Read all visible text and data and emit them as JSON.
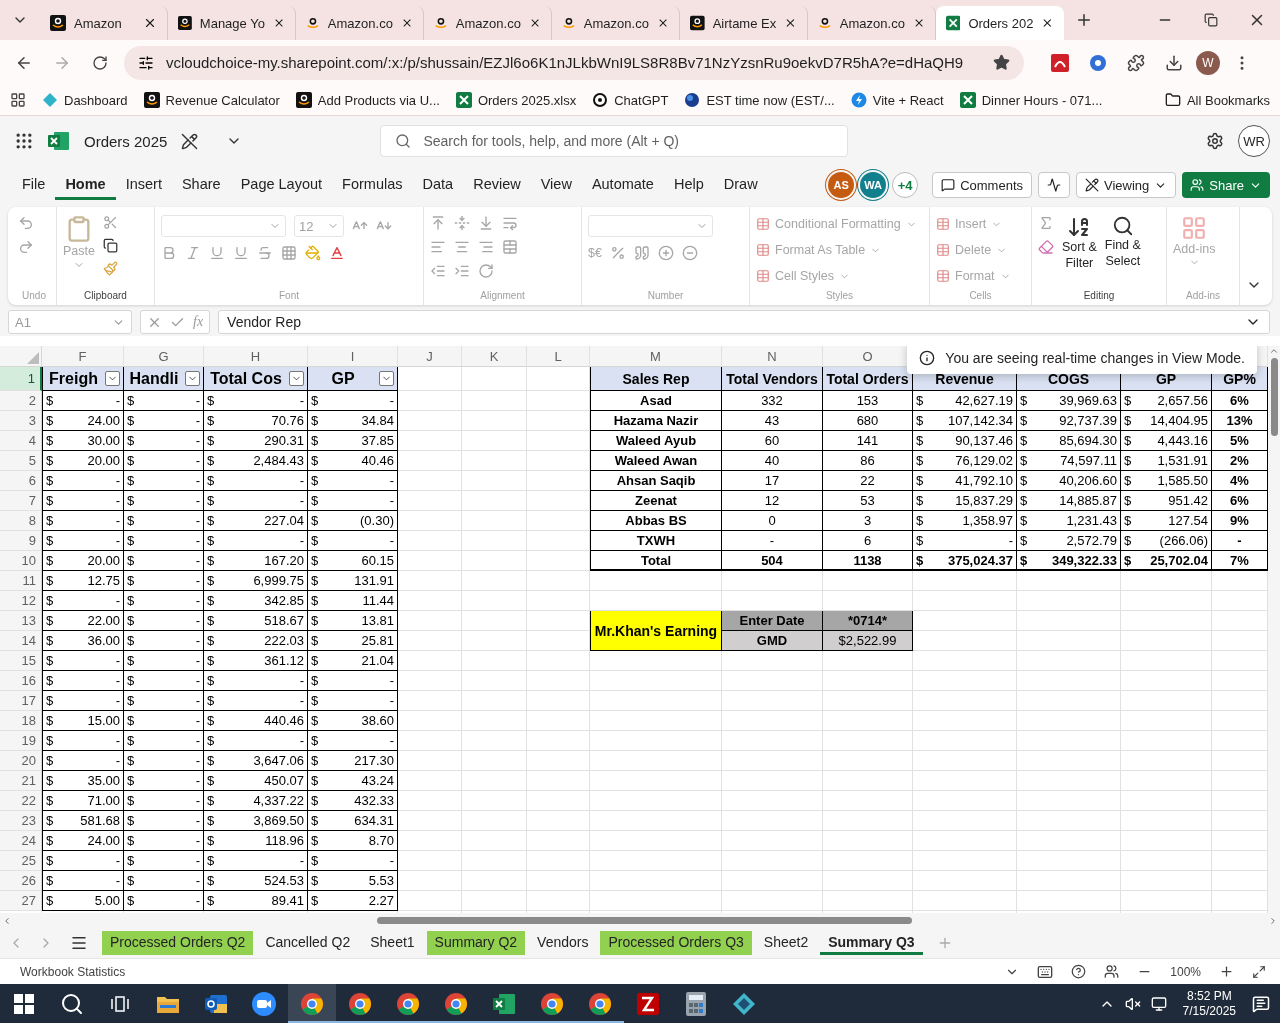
{
  "browser": {
    "tabs": [
      {
        "label": "Amazon",
        "kind": "dark",
        "selected": false
      },
      {
        "label": "Manage Yo",
        "kind": "dark",
        "selected": false
      },
      {
        "label": "Amazon.co",
        "kind": "light",
        "selected": false
      },
      {
        "label": "Amazon.co",
        "kind": "light",
        "selected": false
      },
      {
        "label": "Amazon.co",
        "kind": "light",
        "selected": false
      },
      {
        "label": "Airtame Ex",
        "kind": "dark",
        "selected": false
      },
      {
        "label": "Amazon.co",
        "kind": "light",
        "selected": false
      },
      {
        "label": "Orders 202",
        "kind": "sheet",
        "selected": true
      }
    ],
    "address": "vcloudchoice-my.sharepoint.com/:x:/p/shussain/EZJl6o6K1nJLkbWnI9LS8R8Bv71NzYzsnRu9oekvD7R5hA?e=dHaQH9",
    "profile": "W",
    "bookmarks": [
      {
        "label": "Dashboard",
        "kind": "diamond"
      },
      {
        "label": "Revenue Calculator",
        "kind": "dark"
      },
      {
        "label": "Add Products via U...",
        "kind": "dark"
      },
      {
        "label": "Orders 2025.xlsx",
        "kind": "sheet"
      },
      {
        "label": "ChatGPT",
        "kind": "knot"
      },
      {
        "label": "EST time now (EST/...",
        "kind": "globe"
      },
      {
        "label": "Vite + React",
        "kind": "bolt"
      },
      {
        "label": "Dinner Hours - 071...",
        "kind": "sheet"
      }
    ],
    "all_bookmarks": "All Bookmarks"
  },
  "excel": {
    "title": "Orders 2025",
    "search_placeholder": "Search for tools, help, and more (Alt + Q)",
    "user": "WR",
    "menu": [
      {
        "label": "File",
        "selected": false
      },
      {
        "label": "Home",
        "selected": true
      },
      {
        "label": "Insert",
        "selected": false
      },
      {
        "label": "Share",
        "selected": false
      },
      {
        "label": "Page Layout",
        "selected": false
      },
      {
        "label": "Formulas",
        "selected": false
      },
      {
        "label": "Data",
        "selected": false
      },
      {
        "label": "Review",
        "selected": false
      },
      {
        "label": "View",
        "selected": false
      },
      {
        "label": "Automate",
        "selected": false
      },
      {
        "label": "Help",
        "selected": false
      },
      {
        "label": "Draw",
        "selected": false
      }
    ],
    "presence": [
      {
        "initials": "AS",
        "color": "#c55a11"
      },
      {
        "initials": "WA",
        "color": "#127f8c"
      }
    ],
    "presence_more": "+4",
    "comments": "Comments",
    "viewing": "Viewing",
    "share": "Share",
    "ribbon": [
      {
        "kind": "undo",
        "label": "Undo",
        "disabled": true
      },
      {
        "kind": "clipboard",
        "label": "Clipboard",
        "disabled": false,
        "paste": "Paste"
      },
      {
        "kind": "font",
        "label": "Font",
        "disabled": true,
        "size": "12"
      },
      {
        "kind": "alignment",
        "label": "Alignment",
        "disabled": true
      },
      {
        "kind": "number",
        "label": "Number",
        "disabled": true,
        "currency": "$€"
      },
      {
        "kind": "list",
        "label": "Styles",
        "disabled": true,
        "items": [
          "Conditional Formatting",
          "Format As Table",
          "Cell Styles"
        ]
      },
      {
        "kind": "list",
        "label": "Cells",
        "disabled": true,
        "items": [
          "Insert",
          "Delete",
          "Format"
        ]
      },
      {
        "kind": "editing",
        "label": "Editing",
        "disabled": false,
        "buttons": [
          {
            "lines": [
              "Sort &",
              "Filter"
            ]
          },
          {
            "lines": [
              "Find &",
              "Select"
            ]
          }
        ]
      },
      {
        "kind": "addins",
        "label": "Add-ins",
        "disabled": true,
        "button": "Add-ins"
      }
    ],
    "formula_bar": {
      "name_box": "A1",
      "fx": "fx",
      "value": "Vendor Rep"
    }
  },
  "sheet": {
    "column_headers": [
      "F",
      "G",
      "H",
      "I",
      "J",
      "K",
      "L",
      "M",
      "N",
      "O"
    ],
    "row_numbers": [
      {
        "label": "1",
        "selected": true
      },
      {
        "label": "2",
        "selected": false
      },
      {
        "label": "3",
        "selected": false
      },
      {
        "label": "4",
        "selected": false
      },
      {
        "label": "5",
        "selected": false
      },
      {
        "label": "6",
        "selected": false
      },
      {
        "label": "7",
        "selected": false
      },
      {
        "label": "8",
        "selected": false
      },
      {
        "label": "9",
        "selected": false
      },
      {
        "label": "10",
        "selected": false
      },
      {
        "label": "11",
        "selected": false
      },
      {
        "label": "12",
        "selected": false
      },
      {
        "label": "13",
        "selected": false
      },
      {
        "label": "14",
        "selected": false
      },
      {
        "label": "15",
        "selected": false
      },
      {
        "label": "16",
        "selected": false
      },
      {
        "label": "17",
        "selected": false
      },
      {
        "label": "18",
        "selected": false
      },
      {
        "label": "19",
        "selected": false
      },
      {
        "label": "20",
        "selected": false
      },
      {
        "label": "21",
        "selected": false
      },
      {
        "label": "22",
        "selected": false
      },
      {
        "label": "23",
        "selected": false
      },
      {
        "label": "24",
        "selected": false
      },
      {
        "label": "25",
        "selected": false
      },
      {
        "label": "26",
        "selected": false
      },
      {
        "label": "27",
        "selected": false
      }
    ],
    "left_table": {
      "headers": [
        "Freigh",
        "Handli",
        "Total Cos",
        "GP"
      ],
      "rows": [
        [
          "$",
          "-",
          "$",
          "-",
          "$",
          "-",
          "$",
          "-"
        ],
        [
          "$",
          "24.00",
          "$",
          "-",
          "$",
          "70.76",
          "$",
          "34.84"
        ],
        [
          "$",
          "30.00",
          "$",
          "-",
          "$",
          "290.31",
          "$",
          "37.85"
        ],
        [
          "$",
          "20.00",
          "$",
          "-",
          "$",
          "2,484.43",
          "$",
          "40.46"
        ],
        [
          "$",
          "-",
          "$",
          "-",
          "$",
          "-",
          "$",
          "-"
        ],
        [
          "$",
          "-",
          "$",
          "-",
          "$",
          "-",
          "$",
          "-"
        ],
        [
          "$",
          "-",
          "$",
          "-",
          "$",
          "227.04",
          "$",
          "(0.30)"
        ],
        [
          "$",
          "-",
          "$",
          "-",
          "$",
          "-",
          "$",
          "-"
        ],
        [
          "$",
          "20.00",
          "$",
          "-",
          "$",
          "167.20",
          "$",
          "60.15"
        ],
        [
          "$",
          "12.75",
          "$",
          "-",
          "$",
          "6,999.75",
          "$",
          "131.91"
        ],
        [
          "$",
          "-",
          "$",
          "-",
          "$",
          "342.85",
          "$",
          "11.44"
        ],
        [
          "$",
          "22.00",
          "$",
          "-",
          "$",
          "518.67",
          "$",
          "13.81"
        ],
        [
          "$",
          "36.00",
          "$",
          "-",
          "$",
          "222.03",
          "$",
          "25.81"
        ],
        [
          "$",
          "-",
          "$",
          "-",
          "$",
          "361.12",
          "$",
          "21.04"
        ],
        [
          "$",
          "-",
          "$",
          "-",
          "$",
          "-",
          "$",
          "-"
        ],
        [
          "$",
          "-",
          "$",
          "-",
          "$",
          "-",
          "$",
          "-"
        ],
        [
          "$",
          "15.00",
          "$",
          "-",
          "$",
          "440.46",
          "$",
          "38.60"
        ],
        [
          "$",
          "-",
          "$",
          "-",
          "$",
          "-",
          "$",
          "-"
        ],
        [
          "$",
          "-",
          "$",
          "-",
          "$",
          "3,647.06",
          "$",
          "217.30"
        ],
        [
          "$",
          "35.00",
          "$",
          "-",
          "$",
          "450.07",
          "$",
          "43.24"
        ],
        [
          "$",
          "71.00",
          "$",
          "-",
          "$",
          "4,337.22",
          "$",
          "432.33"
        ],
        [
          "$",
          "581.68",
          "$",
          "-",
          "$",
          "3,869.50",
          "$",
          "634.31"
        ],
        [
          "$",
          "24.00",
          "$",
          "-",
          "$",
          "118.96",
          "$",
          "8.70"
        ],
        [
          "$",
          "-",
          "$",
          "-",
          "$",
          "-",
          "$",
          "-"
        ],
        [
          "$",
          "-",
          "$",
          "-",
          "$",
          "524.53",
          "$",
          "5.53"
        ],
        [
          "$",
          "5.00",
          "$",
          "-",
          "$",
          "89.41",
          "$",
          "2.27"
        ]
      ]
    },
    "summary": {
      "headers": [
        "Sales Rep",
        "Total Vendors",
        "Total Orders",
        "Revenue",
        "COGS",
        "GP",
        "GP%"
      ],
      "rows": [
        {
          "kind": "data",
          "cells": [
            "Asad",
            "332",
            "153",
            [
              "$",
              "42,627.19"
            ],
            [
              "$",
              "39,969.63"
            ],
            [
              "$",
              "2,657.56"
            ],
            "6%"
          ]
        },
        {
          "kind": "data",
          "cells": [
            "Hazama Nazir",
            "43",
            "680",
            [
              "$",
              "107,142.34"
            ],
            [
              "$",
              "92,737.39"
            ],
            [
              "$",
              "14,404.95"
            ],
            "13%"
          ]
        },
        {
          "kind": "data",
          "cells": [
            "Waleed Ayub",
            "60",
            "141",
            [
              "$",
              "90,137.46"
            ],
            [
              "$",
              "85,694.30"
            ],
            [
              "$",
              "4,443.16"
            ],
            "5%"
          ]
        },
        {
          "kind": "data",
          "cells": [
            "Waleed Awan",
            "40",
            "86",
            [
              "$",
              "76,129.02"
            ],
            [
              "$",
              "74,597.11"
            ],
            [
              "$",
              "1,531.91"
            ],
            "2%"
          ]
        },
        {
          "kind": "data",
          "cells": [
            "Ahsan Saqib",
            "17",
            "22",
            [
              "$",
              "41,792.10"
            ],
            [
              "$",
              "40,206.60"
            ],
            [
              "$",
              "1,585.50"
            ],
            "4%"
          ]
        },
        {
          "kind": "data",
          "cells": [
            "Zeenat",
            "12",
            "53",
            [
              "$",
              "15,837.29"
            ],
            [
              "$",
              "14,885.87"
            ],
            [
              "$",
              "951.42"
            ],
            "6%"
          ]
        },
        {
          "kind": "data",
          "cells": [
            "Abbas BS",
            "0",
            "3",
            [
              "$",
              "1,358.97"
            ],
            [
              "$",
              "1,231.43"
            ],
            [
              "$",
              "127.54"
            ],
            "9%"
          ]
        },
        {
          "kind": "data",
          "cells": [
            "TXWH",
            "-",
            "6",
            [
              "$",
              "-"
            ],
            [
              "$",
              "2,572.79"
            ],
            [
              "$",
              "(266.06)"
            ],
            "-"
          ]
        },
        {
          "kind": "total",
          "cells": [
            "Total",
            "504",
            "1138",
            [
              "$",
              "375,024.37"
            ],
            [
              "$",
              "349,322.33"
            ],
            [
              "$",
              "25,702.04"
            ],
            "7%"
          ]
        }
      ]
    },
    "earning": {
      "title": "Mr.Khan's Earning",
      "rows": [
        {
          "label": "Enter Date",
          "value": "*0714*",
          "kind": "input"
        },
        {
          "label": "GMD",
          "value": "$2,522.99",
          "kind": "result"
        }
      ]
    },
    "toast": "You are seeing real-time changes in View Mode."
  },
  "sheet_tabs": [
    {
      "label": "Processed Orders Q2",
      "selected": false,
      "color": "#92d050"
    },
    {
      "label": "Cancelled Q2",
      "selected": false
    },
    {
      "label": "Sheet1",
      "selected": false
    },
    {
      "label": "Summary Q2",
      "selected": false,
      "color": "#92d050"
    },
    {
      "label": "Vendors",
      "selected": false
    },
    {
      "label": "Processed Orders Q3",
      "selected": false,
      "color": "#92d050"
    },
    {
      "label": "Sheet2",
      "selected": false
    },
    {
      "label": "Summary Q3",
      "selected": true
    }
  ],
  "status_bar": {
    "left": "Workbook Statistics",
    "zoom": "100%"
  },
  "taskbar": {
    "apps": [
      {
        "kind": "windows",
        "running": false,
        "active": false
      },
      {
        "kind": "search",
        "running": false,
        "active": false
      },
      {
        "kind": "taskview",
        "running": false,
        "active": false
      },
      {
        "kind": "folder",
        "running": false,
        "active": false
      },
      {
        "kind": "mail",
        "running": false,
        "active": false
      },
      {
        "kind": "video",
        "running": false,
        "active": false
      },
      {
        "kind": "browser",
        "running": true,
        "active": true
      },
      {
        "kind": "browser",
        "running": true,
        "active": false
      },
      {
        "kind": "browser",
        "running": true,
        "active": false
      },
      {
        "kind": "browser",
        "running": true,
        "active": false
      },
      {
        "kind": "spreadsheet",
        "running": true,
        "active": false
      },
      {
        "kind": "browser",
        "running": true,
        "active": false
      },
      {
        "kind": "browser",
        "running": true,
        "active": false
      },
      {
        "kind": "ftp",
        "running": false,
        "active": false
      },
      {
        "kind": "calculator",
        "running": false,
        "active": false
      },
      {
        "kind": "diamond",
        "running": false,
        "active": false
      }
    ],
    "time": "8:52 PM",
    "date": "7/15/2025"
  }
}
